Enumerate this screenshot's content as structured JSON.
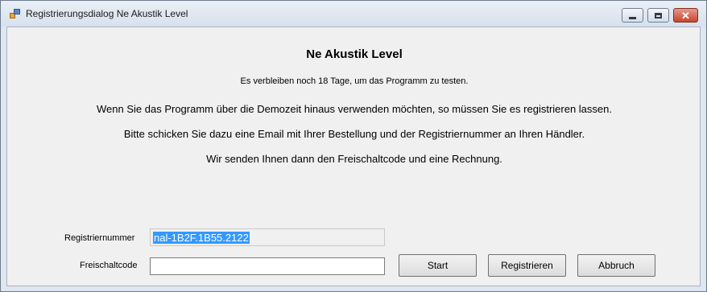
{
  "window": {
    "title": "Registrierungsdialog Ne Akustik Level"
  },
  "dialog": {
    "heading": "Ne Akustik Level",
    "days_remaining": "Es verbleiben noch 18 Tage, um das Programm zu testen.",
    "message_1": "Wenn Sie das Programm über die Demozeit hinaus verwenden möchten, so müssen Sie es registrieren lassen.",
    "message_2": "Bitte schicken Sie dazu eine Email mit Ihrer Bestellung und der Registriernummer an Ihren Händler.",
    "message_3": "Wir senden Ihnen dann den Freischaltcode und eine Rechnung."
  },
  "form": {
    "registration_label": "Registriernummer",
    "registration_value": "nal-1B2F.1B55.2122",
    "unlock_label": "Freischaltcode",
    "unlock_value": ""
  },
  "buttons": {
    "start": "Start",
    "register": "Registrieren",
    "cancel": "Abbruch"
  },
  "icons": {
    "app": "application-icon",
    "minimize": "minimize-icon",
    "maximize": "maximize-icon",
    "close": "close-icon"
  }
}
